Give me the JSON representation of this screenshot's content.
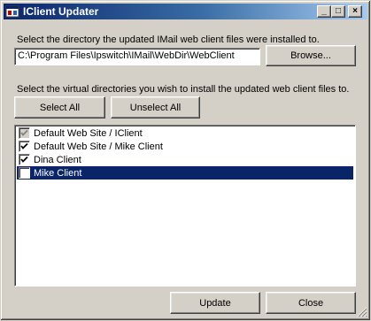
{
  "window": {
    "title": "IClient Updater",
    "controls": {
      "minimize": "_",
      "maximize": "□",
      "close": "×"
    }
  },
  "directory": {
    "prompt": "Select the directory the updated IMail web client files were installed to.",
    "path": "C:\\Program Files\\Ipswitch\\IMail\\WebDir\\WebClient",
    "browse_label": "Browse..."
  },
  "virtual_dirs": {
    "prompt": "Select the virtual directories you wish to install the updated web client files to.",
    "select_all_label": "Select All",
    "unselect_all_label": "Unselect All",
    "items": [
      {
        "label": "Default Web Site / IClient",
        "checked": true,
        "disabled": true,
        "selected": false
      },
      {
        "label": "Default Web Site / Mike Client",
        "checked": true,
        "disabled": false,
        "selected": false
      },
      {
        "label": "Dina Client",
        "checked": true,
        "disabled": false,
        "selected": false
      },
      {
        "label": "Mike Client",
        "checked": false,
        "disabled": false,
        "selected": true
      }
    ]
  },
  "footer": {
    "update_label": "Update",
    "close_label": "Close"
  },
  "colors": {
    "selection": "#0a246a",
    "face": "#d4d0c8"
  }
}
